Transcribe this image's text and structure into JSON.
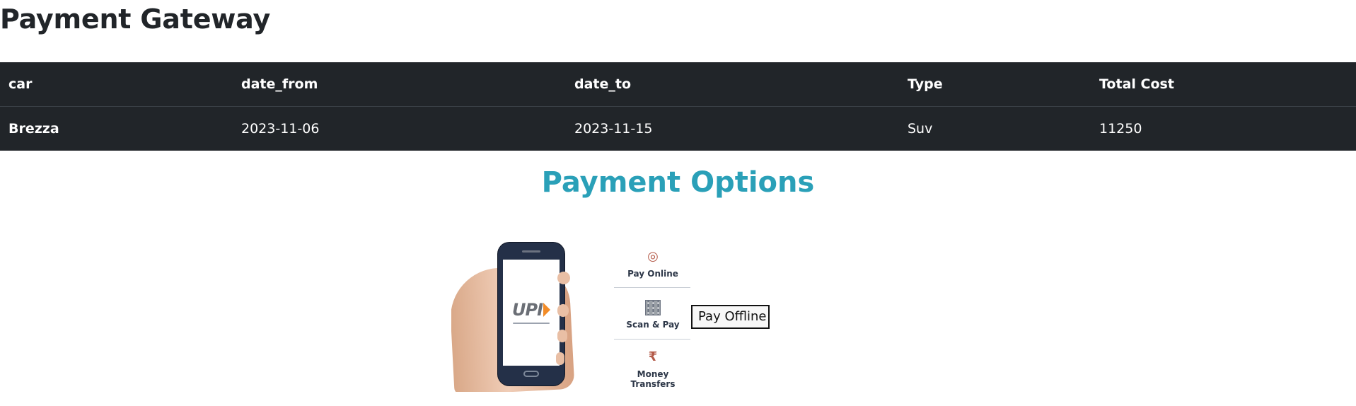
{
  "page": {
    "title": "Payment Gateway"
  },
  "booking": {
    "headers": [
      "car",
      "date_from",
      "date_to",
      "Type",
      "Total Cost"
    ],
    "row": {
      "car": "Brezza",
      "date_from": "2023-11-06",
      "date_to": "2023-11-15",
      "type": "Suv",
      "total_cost": "11250"
    }
  },
  "payment": {
    "title": "Payment Options",
    "image_options": [
      "Pay Online",
      "Scan & Pay",
      "Money Transfers"
    ],
    "logo_text": "UPI",
    "pay_offline_label": "Pay Offline",
    "accent_color": "#2aa0b8"
  },
  "icons": {
    "online": "globe-icon",
    "scan": "qr-code-icon",
    "money": "rupee-transfer-icon",
    "phone": "smartphone-icon"
  }
}
